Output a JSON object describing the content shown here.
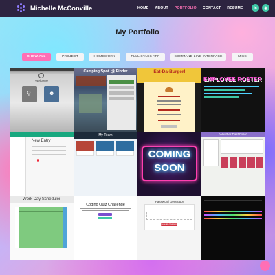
{
  "brand": {
    "name": "Michelle McConville"
  },
  "nav": {
    "items": [
      {
        "label": "HOME"
      },
      {
        "label": "ABOUT"
      },
      {
        "label": "PORTFOLIO",
        "active": true
      },
      {
        "label": "CONTACT"
      },
      {
        "label": "RESUME"
      }
    ],
    "social": {
      "linkedin": "in",
      "github": "◉"
    }
  },
  "page": {
    "title": "My Portfolio"
  },
  "filters": [
    {
      "label": "SHOW ALL",
      "active": true
    },
    {
      "label": "PROJECT"
    },
    {
      "label": "HOMEWORK"
    },
    {
      "label": "FULL STACK APP"
    },
    {
      "label": "COMMAND LINE INTERFACE"
    },
    {
      "label": "MISC"
    }
  ],
  "thumbnails": {
    "t1": {
      "heading": "Welcome"
    },
    "t2": {
      "heading": "Camping Spot 🏕 Finder"
    },
    "t3": {
      "heading": "Eat-Da-Burger!"
    },
    "t4": {
      "heading": "EMPLOYEE ROSTER"
    },
    "t5": {
      "heading": "New Entry"
    },
    "t6": {
      "heading": "My Team"
    },
    "t7": {
      "line1": "COMING",
      "line2": "SOON"
    },
    "t8": {
      "heading": "Weather Dashboard"
    },
    "t9": {
      "heading": "Work Day Scheduler"
    },
    "t10": {
      "heading": "Coding Quiz Challenge"
    },
    "t11": {
      "heading": "Password Generator",
      "button": "Generate Password"
    },
    "t12": {
      "heading": ""
    }
  },
  "colors": {
    "accent": "#ff6fb5",
    "nav_bg": "#2d2440",
    "social": "#3ec8a7"
  },
  "icons": {
    "back_to_top": "arrow-up-icon"
  }
}
